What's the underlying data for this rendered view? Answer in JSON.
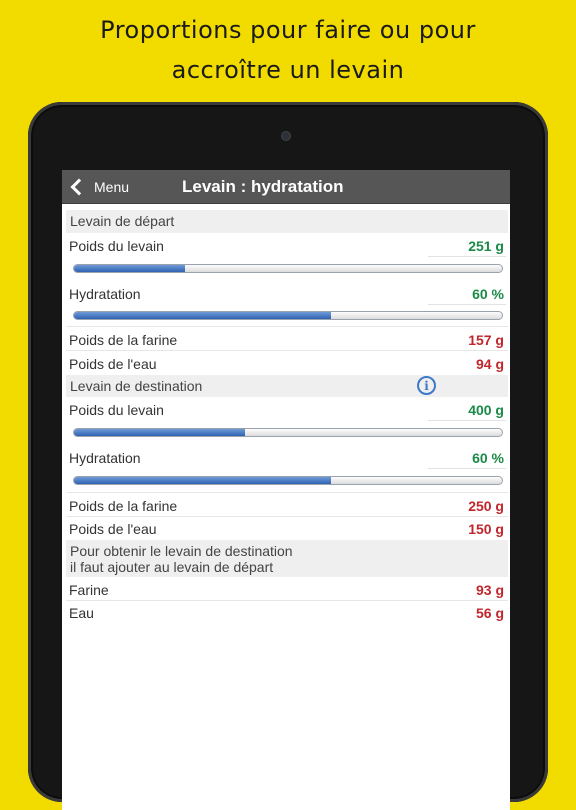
{
  "headline": {
    "line1": "Proportions pour faire ou pour",
    "line2": "accroître un levain"
  },
  "navbar": {
    "back_label": "Menu",
    "title": "Levain : hydratation"
  },
  "start": {
    "section": "Levain de départ",
    "weight_label": "Poids du levain",
    "weight_value": "251 g",
    "weight_slider_fraction": 0.26,
    "hydration_label": "Hydratation",
    "hydration_value": "60 %",
    "hydration_slider_fraction": 0.6,
    "flour_label": "Poids de la farine",
    "flour_value": "157 g",
    "water_label": "Poids de l'eau",
    "water_value": "94 g"
  },
  "target": {
    "section": "Levain de destination",
    "info_icon": "info-icon",
    "weight_label": "Poids du levain",
    "weight_value": "400 g",
    "weight_slider_fraction": 0.4,
    "hydration_label": "Hydratation",
    "hydration_value": "60 %",
    "hydration_slider_fraction": 0.6,
    "flour_label": "Poids de la farine",
    "flour_value": "250 g",
    "water_label": "Poids de l'eau",
    "water_value": "150 g"
  },
  "add": {
    "section_line1": "Pour obtenir le levain de destination",
    "section_line2": "il faut ajouter au levain de départ",
    "flour_label": "Farine",
    "flour_value": "93 g",
    "water_label": "Eau",
    "water_value": "56 g"
  },
  "colors": {
    "background": "#f2dc00",
    "green_value": "#1a8a46",
    "red_value": "#c0272d",
    "slider_fill": "#2f62b3"
  }
}
